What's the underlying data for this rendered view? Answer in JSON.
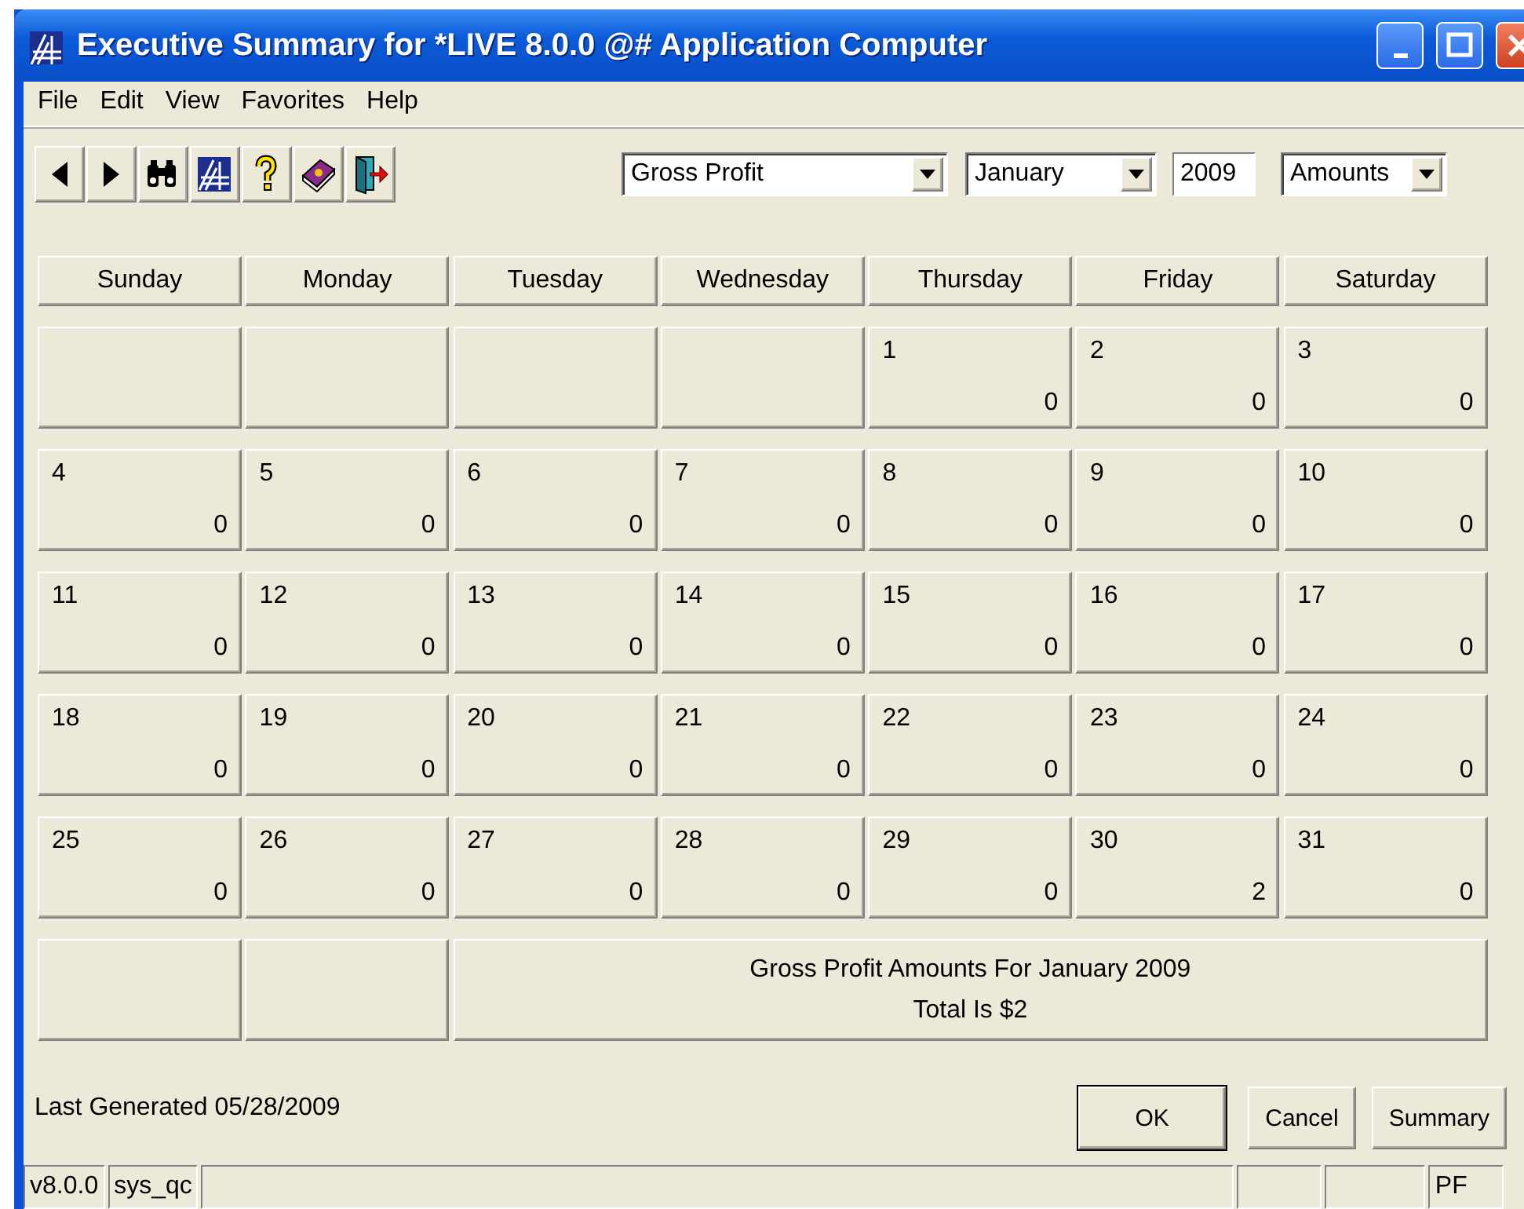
{
  "window": {
    "title": "Executive Summary for *LIVE 8.0.0 @# Application Computer"
  },
  "menu": [
    "File",
    "Edit",
    "View",
    "Favorites",
    "Help"
  ],
  "toolbar": {
    "buttons": [
      {
        "kind": "back"
      },
      {
        "kind": "forward"
      },
      {
        "kind": "find"
      },
      {
        "kind": "logo"
      },
      {
        "kind": "help"
      },
      {
        "kind": "book"
      },
      {
        "kind": "exit"
      }
    ],
    "measure": "Gross Profit",
    "month": "January",
    "year": "2009",
    "mode": "Amounts"
  },
  "calendar": {
    "weekdays": [
      "Sunday",
      "Monday",
      "Tuesday",
      "Wednesday",
      "Thursday",
      "Friday",
      "Saturday"
    ],
    "weeks": [
      [
        {
          "kind": "blank"
        },
        {
          "kind": "blank"
        },
        {
          "kind": "blank"
        },
        {
          "kind": "blank"
        },
        {
          "kind": "day",
          "day": "1",
          "value": "0"
        },
        {
          "kind": "day",
          "day": "2",
          "value": "0"
        },
        {
          "kind": "day",
          "day": "3",
          "value": "0"
        }
      ],
      [
        {
          "kind": "day",
          "day": "4",
          "value": "0"
        },
        {
          "kind": "day",
          "day": "5",
          "value": "0"
        },
        {
          "kind": "day",
          "day": "6",
          "value": "0"
        },
        {
          "kind": "day",
          "day": "7",
          "value": "0"
        },
        {
          "kind": "day",
          "day": "8",
          "value": "0"
        },
        {
          "kind": "day",
          "day": "9",
          "value": "0"
        },
        {
          "kind": "day",
          "day": "10",
          "value": "0"
        }
      ],
      [
        {
          "kind": "day",
          "day": "11",
          "value": "0"
        },
        {
          "kind": "day",
          "day": "12",
          "value": "0"
        },
        {
          "kind": "day",
          "day": "13",
          "value": "0"
        },
        {
          "kind": "day",
          "day": "14",
          "value": "0"
        },
        {
          "kind": "day",
          "day": "15",
          "value": "0"
        },
        {
          "kind": "day",
          "day": "16",
          "value": "0"
        },
        {
          "kind": "day",
          "day": "17",
          "value": "0"
        }
      ],
      [
        {
          "kind": "day",
          "day": "18",
          "value": "0"
        },
        {
          "kind": "day",
          "day": "19",
          "value": "0"
        },
        {
          "kind": "day",
          "day": "20",
          "value": "0"
        },
        {
          "kind": "day",
          "day": "21",
          "value": "0"
        },
        {
          "kind": "day",
          "day": "22",
          "value": "0"
        },
        {
          "kind": "day",
          "day": "23",
          "value": "0"
        },
        {
          "kind": "day",
          "day": "24",
          "value": "0"
        }
      ],
      [
        {
          "kind": "day",
          "day": "25",
          "value": "0"
        },
        {
          "kind": "day",
          "day": "26",
          "value": "0"
        },
        {
          "kind": "day",
          "day": "27",
          "value": "0"
        },
        {
          "kind": "day",
          "day": "28",
          "value": "0"
        },
        {
          "kind": "day",
          "day": "29",
          "value": "0"
        },
        {
          "kind": "day",
          "day": "30",
          "value": "2"
        },
        {
          "kind": "day",
          "day": "31",
          "value": "0"
        }
      ]
    ],
    "summary": [
      "Gross Profit Amounts For January 2009",
      "Total Is $2"
    ]
  },
  "last_generated": "Last Generated 05/28/2009",
  "buttons": [
    {
      "label": "OK",
      "default": true
    },
    {
      "label": "Cancel",
      "default": false
    },
    {
      "label": "Summary",
      "default": false
    }
  ],
  "status_bar": [
    "v8.0.0",
    "sys_qc",
    "PF"
  ]
}
